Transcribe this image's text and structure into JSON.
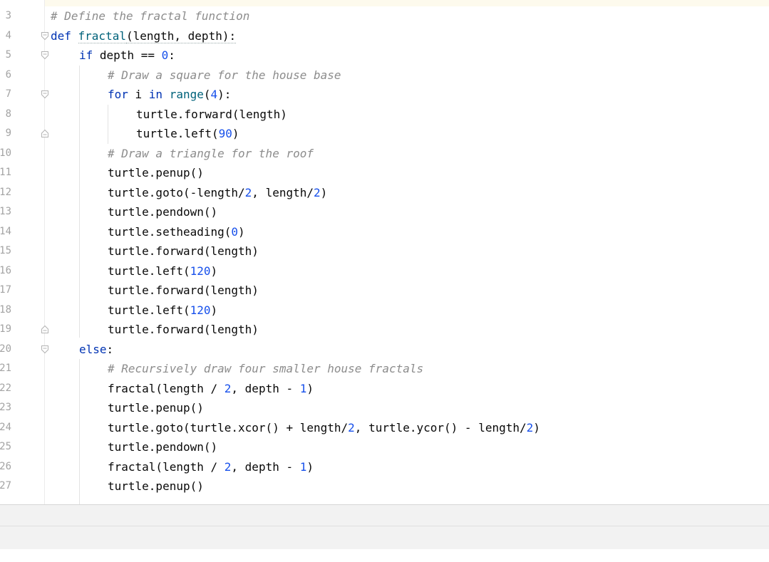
{
  "editor": {
    "lines": [
      {
        "num": "3",
        "tokens": [
          {
            "t": "# Define the fractal function",
            "c": "t-c"
          }
        ]
      },
      {
        "num": "4",
        "tokens": [
          {
            "t": "def ",
            "c": "t-k"
          },
          {
            "t": "fractal",
            "c": "t-f"
          },
          {
            "t": "(length, depth):",
            "c": "t-p"
          }
        ]
      },
      {
        "num": "5",
        "tokens": [
          {
            "t": "if ",
            "c": "t-k"
          },
          {
            "t": "depth == ",
            "c": "t-p"
          },
          {
            "t": "0",
            "c": "t-n"
          },
          {
            "t": ":",
            "c": "t-p"
          }
        ]
      },
      {
        "num": "6",
        "tokens": [
          {
            "t": "# Draw a square for the house base",
            "c": "t-c"
          }
        ]
      },
      {
        "num": "7",
        "tokens": [
          {
            "t": "for ",
            "c": "t-k"
          },
          {
            "t": "i ",
            "c": "t-p"
          },
          {
            "t": "in ",
            "c": "t-k"
          },
          {
            "t": "range",
            "c": "t-f"
          },
          {
            "t": "(",
            "c": "t-p"
          },
          {
            "t": "4",
            "c": "t-n"
          },
          {
            "t": "):",
            "c": "t-p"
          }
        ]
      },
      {
        "num": "8",
        "tokens": [
          {
            "t": "turtle.forward(length)",
            "c": "t-p"
          }
        ]
      },
      {
        "num": "9",
        "tokens": [
          {
            "t": "turtle.left(",
            "c": "t-p"
          },
          {
            "t": "90",
            "c": "t-n"
          },
          {
            "t": ")",
            "c": "t-p"
          }
        ]
      },
      {
        "num": "10",
        "tokens": [
          {
            "t": "# Draw a triangle for the roof",
            "c": "t-c"
          }
        ]
      },
      {
        "num": "11",
        "tokens": [
          {
            "t": "turtle.penup()",
            "c": "t-p"
          }
        ]
      },
      {
        "num": "12",
        "tokens": [
          {
            "t": "turtle.goto(-length/",
            "c": "t-p"
          },
          {
            "t": "2",
            "c": "t-n"
          },
          {
            "t": ", length/",
            "c": "t-p"
          },
          {
            "t": "2",
            "c": "t-n"
          },
          {
            "t": ")",
            "c": "t-p"
          }
        ]
      },
      {
        "num": "13",
        "tokens": [
          {
            "t": "turtle.pendown()",
            "c": "t-p"
          }
        ]
      },
      {
        "num": "14",
        "tokens": [
          {
            "t": "turtle.setheading(",
            "c": "t-p"
          },
          {
            "t": "0",
            "c": "t-n"
          },
          {
            "t": ")",
            "c": "t-p"
          }
        ]
      },
      {
        "num": "15",
        "tokens": [
          {
            "t": "turtle.forward(length)",
            "c": "t-p"
          }
        ]
      },
      {
        "num": "16",
        "tokens": [
          {
            "t": "turtle.left(",
            "c": "t-p"
          },
          {
            "t": "120",
            "c": "t-n"
          },
          {
            "t": ")",
            "c": "t-p"
          }
        ]
      },
      {
        "num": "17",
        "tokens": [
          {
            "t": "turtle.forward(length)",
            "c": "t-p"
          }
        ]
      },
      {
        "num": "18",
        "tokens": [
          {
            "t": "turtle.left(",
            "c": "t-p"
          },
          {
            "t": "120",
            "c": "t-n"
          },
          {
            "t": ")",
            "c": "t-p"
          }
        ]
      },
      {
        "num": "19",
        "tokens": [
          {
            "t": "turtle.forward(length)",
            "c": "t-p"
          }
        ]
      },
      {
        "num": "20",
        "tokens": [
          {
            "t": "else",
            "c": "t-k"
          },
          {
            "t": ":",
            "c": "t-p"
          }
        ]
      },
      {
        "num": "21",
        "tokens": [
          {
            "t": "# Recursively draw four smaller house fractals",
            "c": "t-c"
          }
        ]
      },
      {
        "num": "22",
        "tokens": [
          {
            "t": "fractal(length / ",
            "c": "t-p"
          },
          {
            "t": "2",
            "c": "t-n"
          },
          {
            "t": ", depth - ",
            "c": "t-p"
          },
          {
            "t": "1",
            "c": "t-n"
          },
          {
            "t": ")",
            "c": "t-p"
          }
        ]
      },
      {
        "num": "23",
        "tokens": [
          {
            "t": "turtle.penup()",
            "c": "t-p"
          }
        ]
      },
      {
        "num": "24",
        "tokens": [
          {
            "t": "turtle.goto(turtle.xcor() + length/",
            "c": "t-p"
          },
          {
            "t": "2",
            "c": "t-n"
          },
          {
            "t": ", turtle.ycor() - length/",
            "c": "t-p"
          },
          {
            "t": "2",
            "c": "t-n"
          },
          {
            "t": ")",
            "c": "t-p"
          }
        ]
      },
      {
        "num": "25",
        "tokens": [
          {
            "t": "turtle.pendown()",
            "c": "t-p"
          }
        ]
      },
      {
        "num": "26",
        "tokens": [
          {
            "t": "fractal(length / ",
            "c": "t-p"
          },
          {
            "t": "2",
            "c": "t-n"
          },
          {
            "t": ", depth - ",
            "c": "t-p"
          },
          {
            "t": "1",
            "c": "t-n"
          },
          {
            "t": ")",
            "c": "t-p"
          }
        ]
      },
      {
        "num": "27",
        "tokens": [
          {
            "t": "turtle.penup()",
            "c": "t-p"
          }
        ]
      }
    ]
  }
}
